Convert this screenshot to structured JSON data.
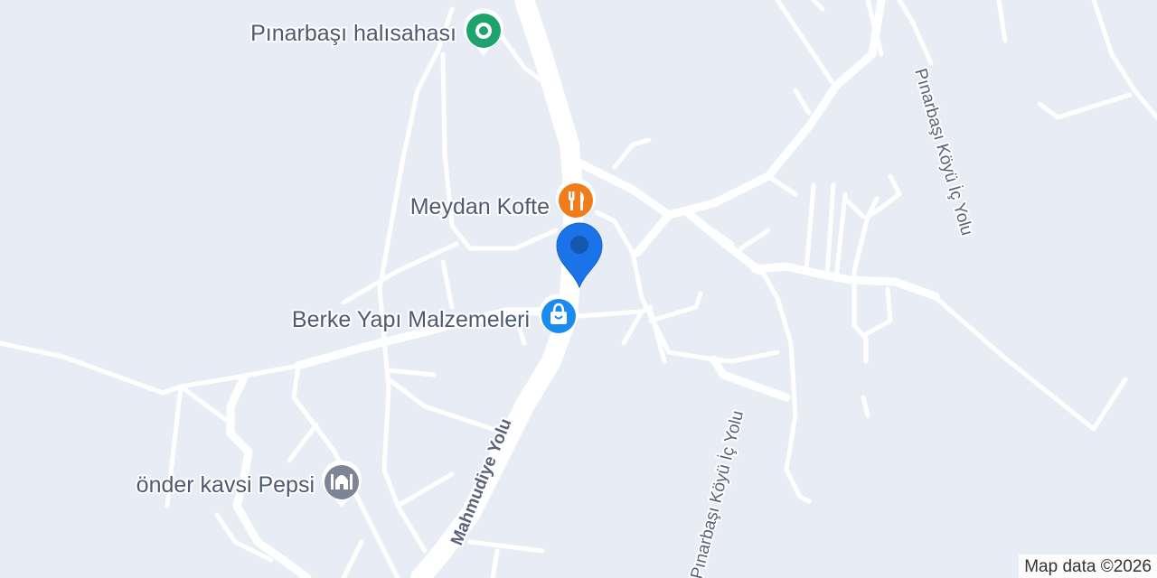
{
  "places": [
    {
      "name": "Pınarbaşı halısahası",
      "category": "sports",
      "icon": "stadium-pin-icon",
      "color": "#1fa36e"
    },
    {
      "name": "Meydan Kofte",
      "category": "restaurant",
      "icon": "fork-knife-icon",
      "color": "#f07c1b"
    },
    {
      "name": "Berke Yapı Malzemeleri",
      "category": "shopping",
      "icon": "shopping-bag-icon",
      "color": "#1a8cf0"
    },
    {
      "name": "önder kavsi Pepsi",
      "category": "worship",
      "icon": "mosque-icon",
      "color": "#7b8595"
    }
  ],
  "roads": {
    "main": "Mahmudiye Yolu",
    "village_north": "Pınarbaşı Köyü İç Yolu",
    "village_south": "Pınarbaşı Köyü İç Yolu"
  },
  "location_marker": {
    "icon": "location-pin-icon",
    "color": "#1a73e8"
  },
  "attribution": "Map data ©2026",
  "colors": {
    "background": "#e8ecf4",
    "road": "#ffffff",
    "label": "#4d5a73"
  }
}
